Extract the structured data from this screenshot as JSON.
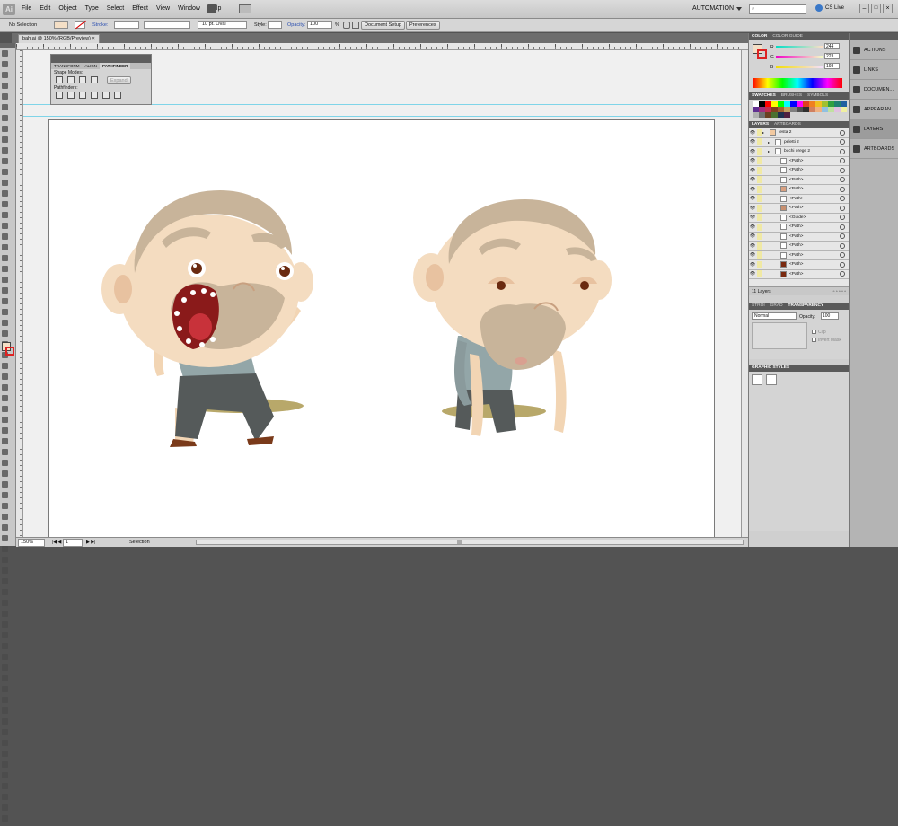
{
  "app": {
    "logo": "Ai",
    "workspace": "AUTOMATION",
    "search_placeholder": "",
    "cs_live": "CS Live"
  },
  "menu": [
    "File",
    "Edit",
    "Object",
    "Type",
    "Select",
    "Effect",
    "View",
    "Window",
    "Help"
  ],
  "control": {
    "selection": "No Selection",
    "stroke_label": "Stroke:",
    "brush": "10 pt. Oval",
    "style_label": "Style:",
    "opacity_label": "Opacity:",
    "opacity_value": "100",
    "percent": "%",
    "doc_setup": "Document Setup",
    "preferences": "Preferences"
  },
  "document": {
    "tab": "bah.ai @ 150% (RGB/Preview)"
  },
  "pathfinder": {
    "tab1": "TRANSFORM",
    "tab2": "ALIGN",
    "tab3": "PATHFINDER",
    "shape_modes": "Shape Modes:",
    "expand": "Expand",
    "pathfinders": "Pathfinders:"
  },
  "status": {
    "zoom": "150%",
    "page": "1",
    "mode": "Selection"
  },
  "color_panel": {
    "tab1": "COLOR",
    "tab2": "COLOR GUIDE",
    "r": "244",
    "g": "223",
    "b": "198",
    "r_label": "R",
    "g_label": "G",
    "b_label": "B"
  },
  "swatches_tabs": [
    "SWATCHES",
    "BRUSHES",
    "SYMBOLS"
  ],
  "swatch_colors": [
    "#ffffff",
    "#000000",
    "#ff0000",
    "#ffff00",
    "#00ff00",
    "#00ffff",
    "#0000ff",
    "#ff00ff",
    "#e04020",
    "#f08020",
    "#f0c020",
    "#a0c030",
    "#30a040",
    "#208070",
    "#2060a0",
    "#603090",
    "#a03080",
    "#c03050",
    "#804020",
    "#a06030",
    "#c0a060",
    "#808080",
    "#505050",
    "#303030",
    "#d08060",
    "#f0b080",
    "#90c0e0",
    "#c0e0a0",
    "#e0c0e0",
    "#f0f0a0",
    "#b0b0b0",
    "#707070",
    "#6a4020",
    "#4a7030",
    "#203050",
    "#502040"
  ],
  "layers_panel": {
    "tab1": "LAYERS",
    "tab2": "ARTBOARDS",
    "count": "11 Layers",
    "rows": [
      {
        "name": "testa 2",
        "thumb": "#f2c9a0"
      },
      {
        "name": "peletti 2",
        "thumb": "#ffffff"
      },
      {
        "name": "buchi orege 2",
        "thumb": "#ffffff"
      },
      {
        "name": "<Path>",
        "thumb": "#ffffff"
      },
      {
        "name": "<Path>",
        "thumb": "#ffffff"
      },
      {
        "name": "<Path>",
        "thumb": "#ffffff"
      },
      {
        "name": "<Path>",
        "thumb": "#d9a080"
      },
      {
        "name": "<Path>",
        "thumb": "#ffffff"
      },
      {
        "name": "<Path>",
        "thumb": "#c89070"
      },
      {
        "name": "<Guide>",
        "thumb": "#ffffff"
      },
      {
        "name": "<Path>",
        "thumb": "#ffffff"
      },
      {
        "name": "<Path>",
        "thumb": "#ffffff"
      },
      {
        "name": "<Path>",
        "thumb": "#ffffff"
      },
      {
        "name": "<Path>",
        "thumb": "#ffffff"
      },
      {
        "name": "<Path>",
        "thumb": "#7a2a10"
      },
      {
        "name": "<Path>",
        "thumb": "#7a2a10"
      }
    ]
  },
  "transparency": {
    "tab1": "STROI",
    "tab2": "GRAD",
    "tab3": "TRANSPARENCY",
    "mode": "Normal",
    "opacity_label": "Opacity:",
    "opacity": "100",
    "clip": "Clip",
    "invert": "Invert Mask"
  },
  "graphic_styles": {
    "tab": "GRAPHIC STYLES"
  },
  "dock": [
    "ACTIONS",
    "LINKS",
    "DOCUMEN...",
    "APPEARAN...",
    "LAYERS",
    "ARTBOARDS"
  ]
}
